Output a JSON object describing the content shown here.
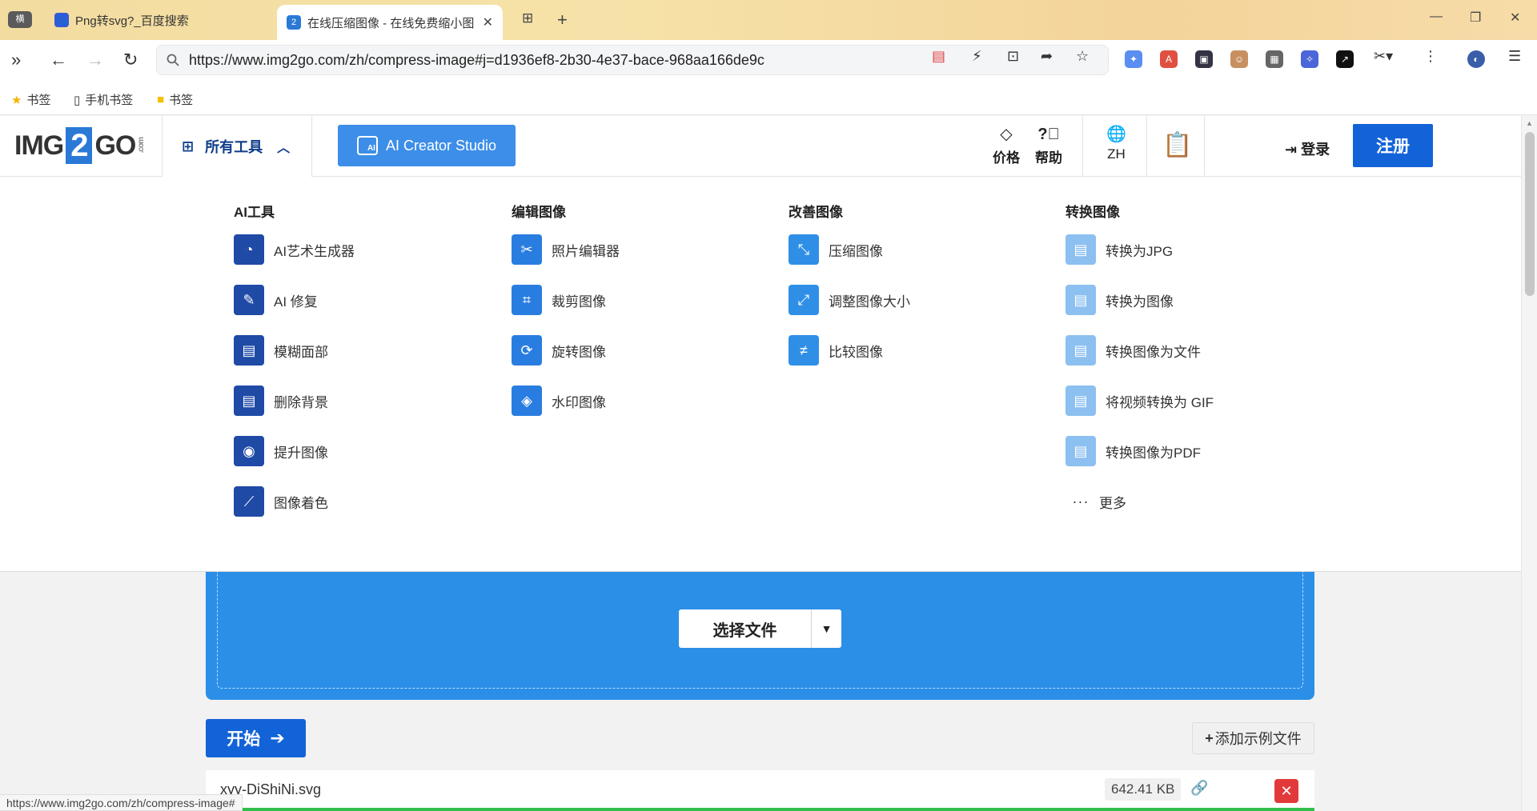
{
  "browser": {
    "tabs": [
      {
        "title": "Png转svg?_百度搜索",
        "icon": "baidu-paw-icon"
      },
      {
        "title": "在线压缩图像 - 在线免费缩小图",
        "icon": "img2go-favicon",
        "active": true
      }
    ],
    "mini_tab_label": "横",
    "url": "https://www.img2go.com/zh/compress-image#j=d1936ef8-2b30-4e37-bace-968aa166de9c",
    "bookmarks": [
      "书签",
      "手机书签",
      "书签"
    ],
    "status_url": "https://www.img2go.com/zh/compress-image#"
  },
  "header": {
    "logo_left": "IMG",
    "logo_num": "2",
    "logo_right": "GO",
    "logo_suffix": ".com",
    "all_tools": "所有工具",
    "ai_creator": "AI Creator Studio",
    "ai_badge": "AI",
    "pricing": "价格",
    "help": "帮助",
    "lang": "ZH",
    "login": "登录",
    "signup": "注册"
  },
  "menu": {
    "columns": [
      {
        "heading": "AI工具",
        "items": [
          {
            "label": "AI艺术生成器",
            "icon": "palette-icon",
            "glyph": "🎨"
          },
          {
            "label": "AI 修复",
            "icon": "edit-icon",
            "glyph": "✎"
          },
          {
            "label": "模糊面部",
            "icon": "file-image-icon",
            "glyph": "▤"
          },
          {
            "label": "删除背景",
            "icon": "file-image-icon",
            "glyph": "▤"
          },
          {
            "label": "提升图像",
            "icon": "eye-icon",
            "glyph": "◉"
          },
          {
            "label": "图像着色",
            "icon": "brush-icon",
            "glyph": "🖌"
          }
        ]
      },
      {
        "heading": "编辑图像",
        "items": [
          {
            "label": "照片编辑器",
            "icon": "tools-icon",
            "glyph": "✂"
          },
          {
            "label": "裁剪图像",
            "icon": "crop-icon",
            "glyph": "⌗"
          },
          {
            "label": "旋转图像",
            "icon": "rotate-icon",
            "glyph": "⟳"
          },
          {
            "label": "水印图像",
            "icon": "droplet-icon",
            "glyph": "💧"
          }
        ]
      },
      {
        "heading": "改善图像",
        "items": [
          {
            "label": "压缩图像",
            "icon": "compress-icon",
            "glyph": "⤡"
          },
          {
            "label": "调整图像大小",
            "icon": "expand-icon",
            "glyph": "⤢"
          },
          {
            "label": "比较图像",
            "icon": "not-equal-icon",
            "glyph": "≠"
          }
        ]
      },
      {
        "heading": "转换图像",
        "items": [
          {
            "label": "转换为JPG",
            "icon": "file-image-icon",
            "glyph": "▤"
          },
          {
            "label": "转换为图像",
            "icon": "file-image-icon",
            "glyph": "▤"
          },
          {
            "label": "转换图像为文件",
            "icon": "file-icon",
            "glyph": "▤"
          },
          {
            "label": "将视频转换为 GIF",
            "icon": "file-video-icon",
            "glyph": "▤"
          },
          {
            "label": "转换图像为PDF",
            "icon": "file-pdf-icon",
            "glyph": "▤"
          }
        ],
        "more": "更多"
      }
    ]
  },
  "main": {
    "choose_file": "选择文件",
    "start": "开始",
    "add_sample": "添加示例文件",
    "file": {
      "name": "xyy-DiShiNi.svg",
      "size": "642.41 KB"
    }
  },
  "colors": {
    "brand_blue": "#1363d8",
    "upload_blue": "#2b8fe8",
    "ai_button": "#3c8ee8",
    "delete_red": "#e23a3a",
    "progress_green": "#2fbf4a"
  }
}
